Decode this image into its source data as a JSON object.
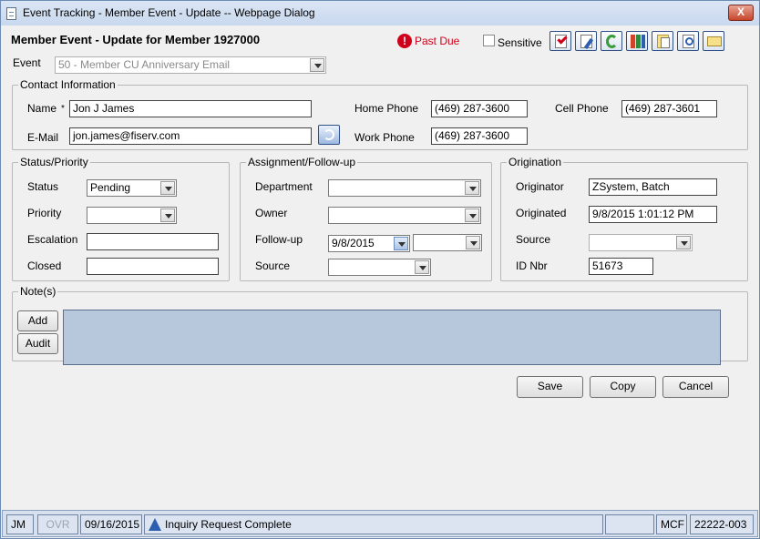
{
  "window": {
    "title": "Event Tracking - Member Event - Update -- Webpage Dialog",
    "close_label": "X"
  },
  "header": {
    "title": "Member Event - Update for Member 1927000",
    "past_due": "Past Due",
    "sensitive_label": "Sensitive",
    "toolbar": [
      "checklist-icon",
      "edit-doc-icon",
      "transfer-icon",
      "books-icon",
      "copy-doc-icon",
      "search-doc-icon",
      "email-icon"
    ]
  },
  "event": {
    "label": "Event",
    "value": "50 - Member CU Anniversary Email"
  },
  "contact": {
    "legend": "Contact Information",
    "name_label": "Name",
    "required_mark": "*",
    "name_value": "Jon J James",
    "email_label": "E-Mail",
    "email_value": "jon.james@fiserv.com",
    "home_phone_label": "Home Phone",
    "home_phone_value": "(469) 287-3600",
    "work_phone_label": "Work Phone",
    "work_phone_value": "(469) 287-3600",
    "cell_phone_label": "Cell Phone",
    "cell_phone_value": "(469) 287-3601"
  },
  "status": {
    "legend": "Status/Priority",
    "status_label": "Status",
    "status_value": "Pending",
    "priority_label": "Priority",
    "priority_value": "",
    "escalation_label": "Escalation",
    "escalation_value": "",
    "closed_label": "Closed",
    "closed_value": ""
  },
  "assignment": {
    "legend": "Assignment/Follow-up",
    "department_label": "Department",
    "department_value": "",
    "owner_label": "Owner",
    "owner_value": "",
    "followup_label": "Follow-up",
    "followup_date": "9/8/2015",
    "followup_time": "",
    "source_label": "Source",
    "source_value": ""
  },
  "origination": {
    "legend": "Origination",
    "originator_label": "Originator",
    "originator_value": "ZSystem, Batch",
    "originated_label": "Originated",
    "originated_value": "9/8/2015 1:01:12 PM",
    "source_label": "Source",
    "source_value": "",
    "id_label": "ID Nbr",
    "id_value": "51673"
  },
  "notes": {
    "legend": "Note(s)",
    "add_label": "Add",
    "audit_label": "Audit"
  },
  "actions": {
    "save": "Save",
    "copy": "Copy",
    "cancel": "Cancel"
  },
  "status_bar": {
    "user": "JM",
    "ovr": "OVR",
    "date": "09/16/2015",
    "message": "Inquiry Request Complete",
    "blank": "",
    "mcf": "MCF",
    "code": "22222-003"
  },
  "colors": {
    "past_due": "#d0021b",
    "notes_bg": "#b7c8dc"
  }
}
